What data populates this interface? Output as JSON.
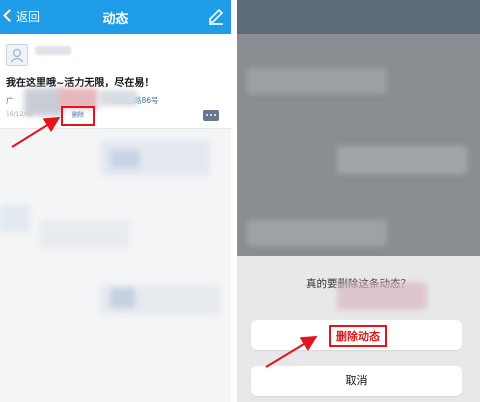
{
  "left_screen": {
    "header": {
      "back_label": "返回",
      "title": "动态",
      "edit_icon": "pencil-icon"
    },
    "post": {
      "text": "我在这里哦~活力无限，尽在易！",
      "location_prefix": "广",
      "location_suffix": "南坛西路86号",
      "timestamp": "16/12/06",
      "delete_label": "删除",
      "comment_icon": "comment-bubble-icon"
    }
  },
  "right_screen": {
    "dialog": {
      "message": "真的要删除这条动态？",
      "confirm_label": "删除动态",
      "cancel_label": "取消"
    }
  },
  "colors": {
    "header_blue": "#1e9ce8",
    "annotation_red": "#e3141c",
    "overlay_gray": "#7a7e83"
  }
}
